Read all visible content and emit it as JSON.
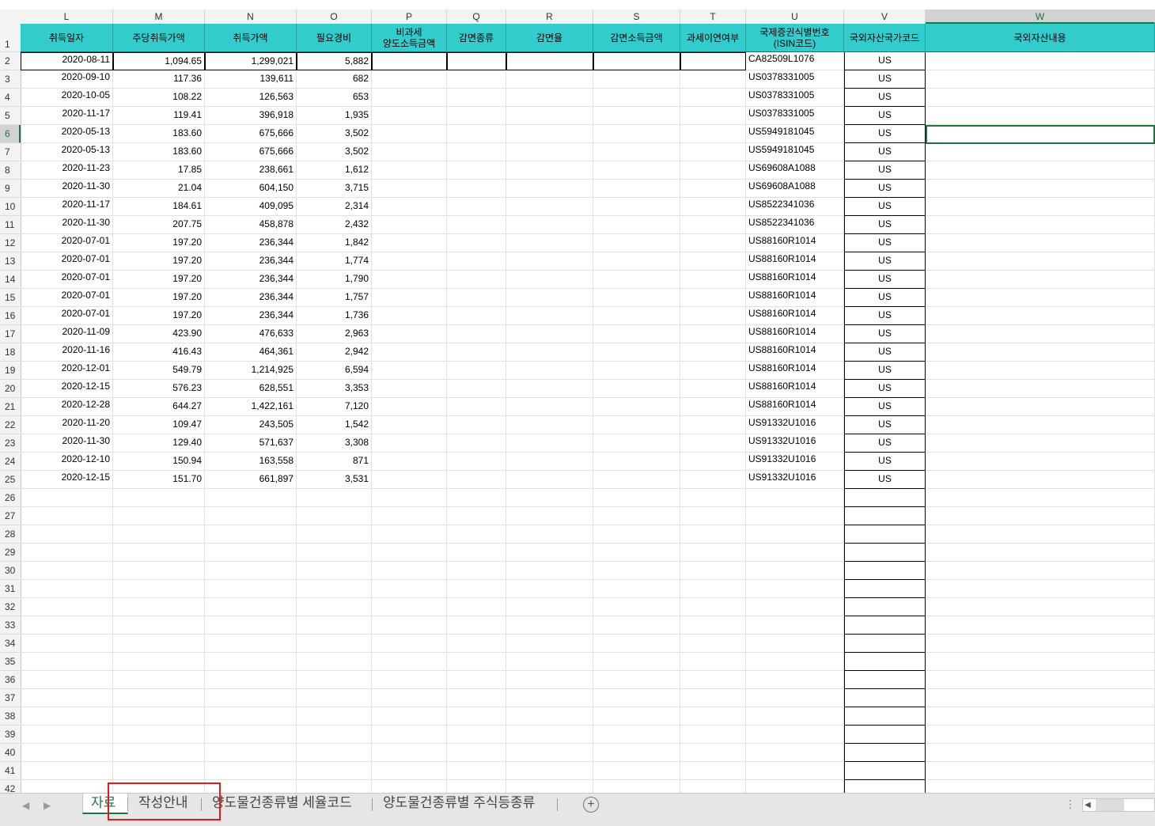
{
  "columns": [
    "L",
    "M",
    "N",
    "O",
    "P",
    "Q",
    "R",
    "S",
    "T",
    "U",
    "V",
    "W"
  ],
  "selected_column": "W",
  "header_row": [
    "취득일자",
    "주당취득가액",
    "취득가액",
    "필요경비",
    "비과세\n양도소득금액",
    "감면종류",
    "감면율",
    "감면소득금액",
    "과세이연여부",
    "국제증권식별번호\n(ISIN코드)",
    "국외자산국가코드",
    "국외자산내용"
  ],
  "row_numbers": [
    "1",
    "2",
    "3",
    "4",
    "5",
    "6",
    "7",
    "8",
    "9",
    "10",
    "11",
    "12",
    "13",
    "14",
    "15",
    "16",
    "17",
    "18",
    "19",
    "20",
    "21",
    "22",
    "23",
    "24",
    "25",
    "26",
    "27",
    "28",
    "29",
    "30",
    "31",
    "32",
    "33",
    "34",
    "35",
    "36",
    "37",
    "38",
    "39",
    "40",
    "41",
    "42"
  ],
  "selected_row": "6",
  "rows": [
    [
      "2020-08-11",
      "1,094.65",
      "1,299,021",
      "5,882",
      "CA82509L1076",
      "US"
    ],
    [
      "2020-09-10",
      "117.36",
      "139,611",
      "682",
      "US0378331005",
      "US"
    ],
    [
      "2020-10-05",
      "108.22",
      "126,563",
      "653",
      "US0378331005",
      "US"
    ],
    [
      "2020-11-17",
      "119.41",
      "396,918",
      "1,935",
      "US0378331005",
      "US"
    ],
    [
      "2020-05-13",
      "183.60",
      "675,666",
      "3,502",
      "US5949181045",
      "US"
    ],
    [
      "2020-05-13",
      "183.60",
      "675,666",
      "3,502",
      "US5949181045",
      "US"
    ],
    [
      "2020-11-23",
      "17.85",
      "238,661",
      "1,612",
      "US69608A1088",
      "US"
    ],
    [
      "2020-11-30",
      "21.04",
      "604,150",
      "3,715",
      "US69608A1088",
      "US"
    ],
    [
      "2020-11-17",
      "184.61",
      "409,095",
      "2,314",
      "US8522341036",
      "US"
    ],
    [
      "2020-11-30",
      "207.75",
      "458,878",
      "2,432",
      "US8522341036",
      "US"
    ],
    [
      "2020-07-01",
      "197.20",
      "236,344",
      "1,842",
      "US88160R1014",
      "US"
    ],
    [
      "2020-07-01",
      "197.20",
      "236,344",
      "1,774",
      "US88160R1014",
      "US"
    ],
    [
      "2020-07-01",
      "197.20",
      "236,344",
      "1,790",
      "US88160R1014",
      "US"
    ],
    [
      "2020-07-01",
      "197.20",
      "236,344",
      "1,757",
      "US88160R1014",
      "US"
    ],
    [
      "2020-07-01",
      "197.20",
      "236,344",
      "1,736",
      "US88160R1014",
      "US"
    ],
    [
      "2020-11-09",
      "423.90",
      "476,633",
      "2,963",
      "US88160R1014",
      "US"
    ],
    [
      "2020-11-16",
      "416.43",
      "464,361",
      "2,942",
      "US88160R1014",
      "US"
    ],
    [
      "2020-12-01",
      "549.79",
      "1,214,925",
      "6,594",
      "US88160R1014",
      "US"
    ],
    [
      "2020-12-15",
      "576.23",
      "628,551",
      "3,353",
      "US88160R1014",
      "US"
    ],
    [
      "2020-12-28",
      "644.27",
      "1,422,161",
      "7,120",
      "US88160R1014",
      "US"
    ],
    [
      "2020-11-20",
      "109.47",
      "243,505",
      "1,542",
      "US91332U1016",
      "US"
    ],
    [
      "2020-11-30",
      "129.40",
      "571,637",
      "3,308",
      "US91332U1016",
      "US"
    ],
    [
      "2020-12-10",
      "150.94",
      "163,558",
      "871",
      "US91332U1016",
      "US"
    ],
    [
      "2020-12-15",
      "151.70",
      "661,897",
      "3,531",
      "US91332U1016",
      "US"
    ]
  ],
  "sheet_tabs": [
    "자료",
    "작성안내",
    "양도물건종류별 세율코드",
    "양도물건종류별 주식등종류"
  ],
  "active_tab": "자료",
  "add_sheet_symbol": "+",
  "colors": {
    "header_fill": "#33cccc",
    "excel_green": "#217346",
    "highlight_box": "#e01b1b"
  }
}
